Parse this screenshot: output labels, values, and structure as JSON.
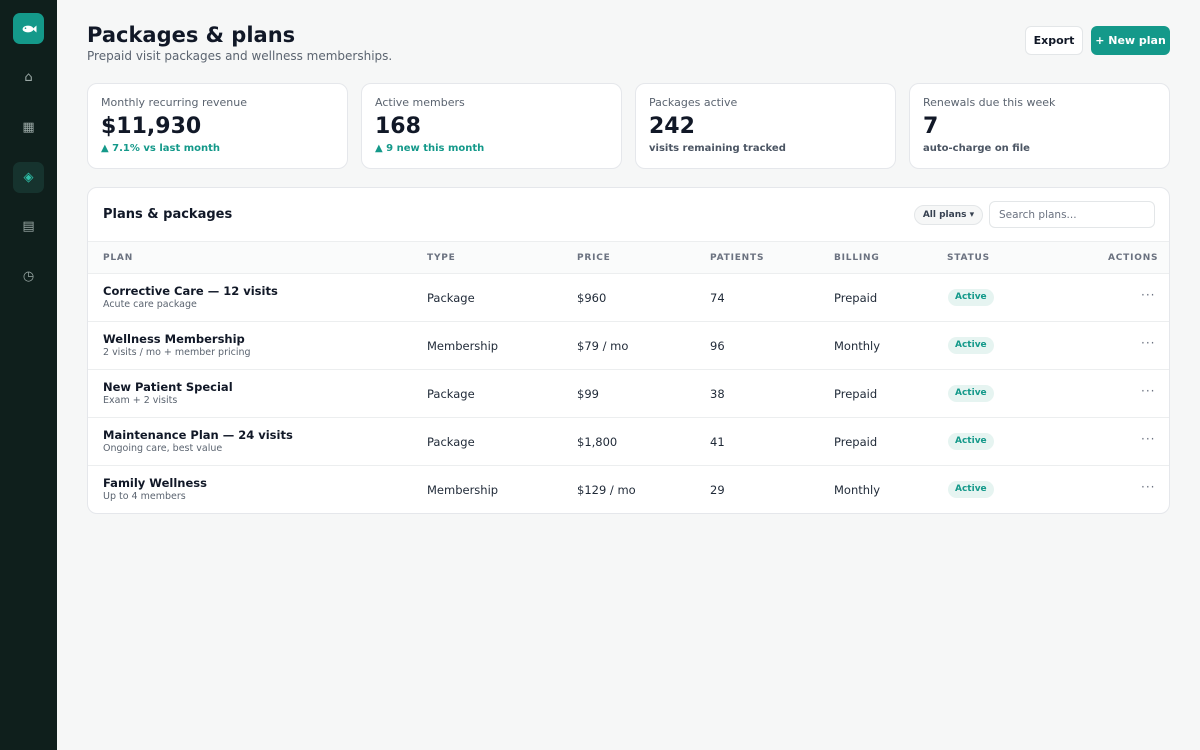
{
  "sidebar": {
    "logo_icon": "fish-logo-icon",
    "items": [
      {
        "name": "home",
        "icon": "⌂"
      },
      {
        "name": "calendar",
        "icon": "▦"
      },
      {
        "name": "plans",
        "icon": "◈",
        "active": true
      },
      {
        "name": "documents",
        "icon": "▤"
      },
      {
        "name": "history",
        "icon": "◷"
      }
    ]
  },
  "header": {
    "title": "Packages & plans",
    "subtitle": "Prepaid visit packages and wellness memberships.",
    "export_label": "Export",
    "new_plan_label": "+ New plan"
  },
  "stats": [
    {
      "label": "Monthly recurring revenue",
      "value": "$11,930",
      "note": "▲ 7.1% vs last month"
    },
    {
      "label": "Active members",
      "value": "168",
      "note": "▲ 9 new this month"
    },
    {
      "label": "Packages active",
      "value": "242",
      "note": "visits remaining tracked"
    },
    {
      "label": "Renewals due this week",
      "value": "7",
      "note": "auto-charge on file"
    }
  ],
  "table": {
    "title": "Plans & packages",
    "filter_label": "All plans ▾",
    "search_placeholder": "Search plans...",
    "columns": [
      "PLAN",
      "TYPE",
      "PRICE",
      "PATIENTS",
      "BILLING",
      "STATUS",
      "ACTIONS"
    ],
    "rows": [
      {
        "name": "Corrective Care — 12 visits",
        "desc": "Acute care package",
        "type": "Package",
        "price": "$960",
        "patients": "74",
        "billing": "Prepaid",
        "status": "Active",
        "actions": "···"
      },
      {
        "name": "Wellness Membership",
        "desc": "2 visits / mo + member pricing",
        "type": "Membership",
        "price": "$79 / mo",
        "patients": "96",
        "billing": "Monthly",
        "status": "Active",
        "actions": "···"
      },
      {
        "name": "New Patient Special",
        "desc": "Exam + 2 visits",
        "type": "Package",
        "price": "$99",
        "patients": "38",
        "billing": "Prepaid",
        "status": "Active",
        "actions": "···"
      },
      {
        "name": "Maintenance Plan — 24 visits",
        "desc": "Ongoing care, best value",
        "type": "Package",
        "price": "$1,800",
        "patients": "41",
        "billing": "Prepaid",
        "status": "Active",
        "actions": "···"
      },
      {
        "name": "Family Wellness",
        "desc": "Up to 4 members",
        "type": "Membership",
        "price": "$129 / mo",
        "patients": "29",
        "billing": "Monthly",
        "status": "Active",
        "actions": "···"
      }
    ]
  },
  "colors": {
    "accent": "#14998a",
    "sidebar_bg": "#0f1f1c",
    "badge_bg": "#e6f4f1"
  }
}
